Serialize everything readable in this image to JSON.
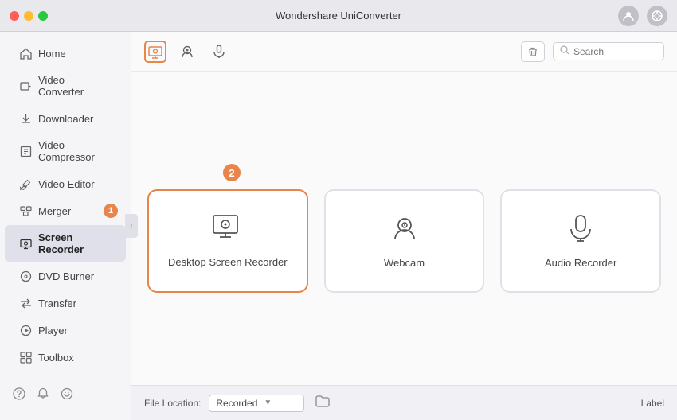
{
  "titlebar": {
    "title": "Wondershare UniConverter",
    "buttons": {
      "close": "close",
      "minimize": "minimize",
      "maximize": "maximize"
    }
  },
  "sidebar": {
    "items": [
      {
        "id": "home",
        "label": "Home",
        "icon": "⌂",
        "badge": null,
        "active": false
      },
      {
        "id": "video-converter",
        "label": "Video Converter",
        "icon": "▶",
        "badge": null,
        "active": false
      },
      {
        "id": "downloader",
        "label": "Downloader",
        "icon": "↓",
        "badge": null,
        "active": false
      },
      {
        "id": "video-compressor",
        "label": "Video Compressor",
        "icon": "⊡",
        "badge": null,
        "active": false
      },
      {
        "id": "video-editor",
        "label": "Video Editor",
        "icon": "✂",
        "badge": null,
        "active": false
      },
      {
        "id": "merger",
        "label": "Merger",
        "icon": "⊞",
        "badge": "1",
        "active": false
      },
      {
        "id": "screen-recorder",
        "label": "Screen Recorder",
        "icon": "▣",
        "badge": null,
        "active": true
      },
      {
        "id": "dvd-burner",
        "label": "DVD Burner",
        "icon": "◎",
        "badge": null,
        "active": false
      },
      {
        "id": "transfer",
        "label": "Transfer",
        "icon": "⇄",
        "badge": null,
        "active": false
      },
      {
        "id": "player",
        "label": "Player",
        "icon": "▷",
        "badge": null,
        "active": false
      },
      {
        "id": "toolbox",
        "label": "Toolbox",
        "icon": "⊞",
        "badge": null,
        "active": false
      }
    ],
    "footer": {
      "help_icon": "?",
      "bell_icon": "🔔",
      "refresh_icon": "↻"
    }
  },
  "header": {
    "tabs": [
      {
        "id": "screen",
        "active": true
      },
      {
        "id": "webcam",
        "active": false
      },
      {
        "id": "audio",
        "active": false
      }
    ],
    "search_placeholder": "Search",
    "badge2": "2"
  },
  "recorder_cards": [
    {
      "id": "desktop",
      "label": "Desktop Screen Recorder",
      "active": true
    },
    {
      "id": "webcam",
      "label": "Webcam",
      "active": false
    },
    {
      "id": "audio",
      "label": "Audio Recorder",
      "active": false
    }
  ],
  "footer": {
    "file_location_label": "File Location:",
    "location_value": "Recorded",
    "label_right": "Label"
  }
}
